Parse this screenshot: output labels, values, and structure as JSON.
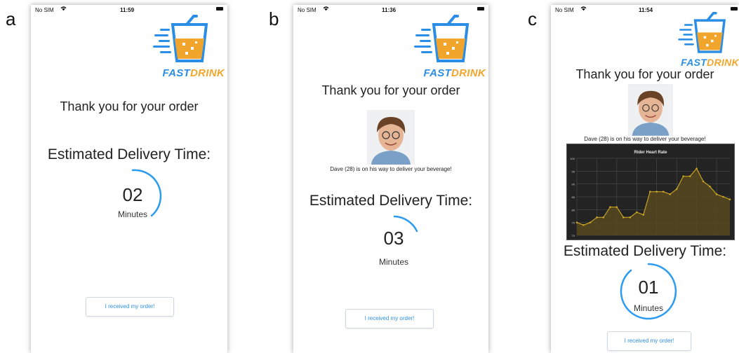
{
  "panel_labels": [
    "a",
    "b",
    "c"
  ],
  "brand": {
    "part1": "FAST",
    "part2": "DRINK",
    "primary": "#2b8ee6",
    "accent": "#f2a52c"
  },
  "thank_you": "Thank you for your order",
  "estimated_label": "Estimated Delivery Time:",
  "minutes_label": "Minutes",
  "received_button": "I received my order!",
  "rider_message": "Dave (28) is on his way to deliver your beverage!",
  "screens": [
    {
      "status": {
        "carrier": "No SIM",
        "time": "11:59"
      },
      "minutes": "02",
      "progress": 0.3
    },
    {
      "status": {
        "carrier": "No SIM",
        "time": "11:36"
      },
      "minutes": "03",
      "progress": 0.12
    },
    {
      "status": {
        "carrier": "No SIM",
        "time": "11:54"
      },
      "minutes": "01",
      "progress": 0.88
    }
  ],
  "chart_data": {
    "type": "line",
    "title": "Rider Heart Rate",
    "ylim": [
      70,
      100
    ],
    "yticks": [
      "100",
      "95",
      "90",
      "85",
      "80",
      "75",
      "70"
    ],
    "x": [
      1,
      2,
      3,
      4,
      5,
      6,
      7,
      8,
      9,
      10,
      11,
      12,
      13,
      14,
      15,
      16,
      17,
      18,
      19,
      20,
      21,
      22,
      23,
      24
    ],
    "values": [
      75,
      74,
      75,
      77,
      77,
      81,
      81,
      77,
      77,
      79,
      78,
      87,
      87,
      87,
      86,
      88,
      93,
      93,
      96,
      91,
      89,
      86,
      85,
      84
    ],
    "grid": true,
    "colors": {
      "background": "#232323",
      "line": "#c8a326",
      "fill": "#5a4a1e",
      "grid": "#555555"
    }
  }
}
